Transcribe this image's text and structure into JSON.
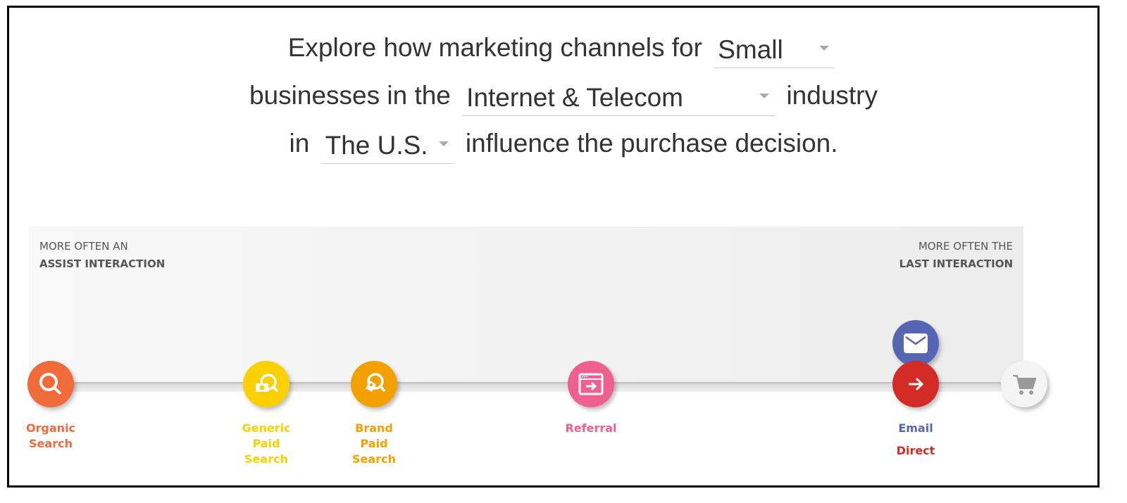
{
  "sentence": {
    "part1": "Explore how marketing channels for",
    "size_select": "Small",
    "part2": "businesses in the",
    "industry_select": "Internet & Telecom",
    "part3": "industry",
    "part4": "in",
    "country_select": "The U.S.",
    "part5": "influence the purchase decision."
  },
  "axis": {
    "left_line1": "MORE OFTEN AN",
    "left_line2": "ASSIST INTERACTION",
    "right_line1": "MORE OFTEN THE",
    "right_line2": "LAST INTERACTION"
  },
  "channels": [
    {
      "label": "Organic Search",
      "color": "#ef6b3a",
      "icon": "search-icon"
    },
    {
      "label": "Generic Paid Search",
      "color": "#fbd000",
      "icon": "money-search-icon"
    },
    {
      "label": "Brand Paid Search",
      "color": "#f2a100",
      "icon": "tag-search-icon"
    },
    {
      "label": "Referral",
      "color": "#ef5f8f",
      "icon": "browser-arrow-icon"
    },
    {
      "label": "Email",
      "color": "#5766b3",
      "icon": "envelope-icon"
    },
    {
      "label": "Direct",
      "color": "#d32b26",
      "icon": "arrow-right-icon"
    }
  ],
  "end_icon": "cart-icon"
}
